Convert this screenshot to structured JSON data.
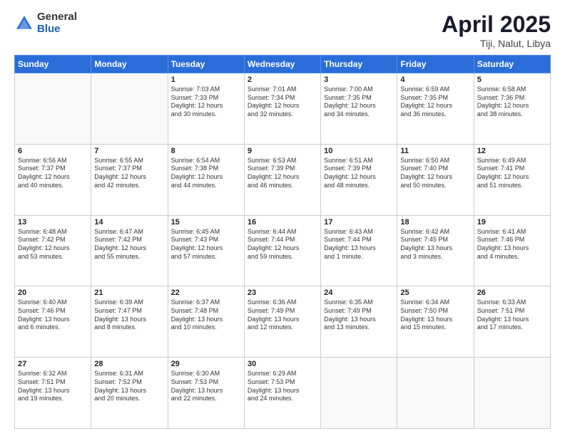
{
  "header": {
    "logo_general": "General",
    "logo_blue": "Blue",
    "title": "April 2025",
    "location": "Tiji, Nalut, Libya"
  },
  "days_of_week": [
    "Sunday",
    "Monday",
    "Tuesday",
    "Wednesday",
    "Thursday",
    "Friday",
    "Saturday"
  ],
  "weeks": [
    [
      {
        "day": "",
        "info": ""
      },
      {
        "day": "",
        "info": ""
      },
      {
        "day": "1",
        "info": "Sunrise: 7:03 AM\nSunset: 7:33 PM\nDaylight: 12 hours\nand 30 minutes."
      },
      {
        "day": "2",
        "info": "Sunrise: 7:01 AM\nSunset: 7:34 PM\nDaylight: 12 hours\nand 32 minutes."
      },
      {
        "day": "3",
        "info": "Sunrise: 7:00 AM\nSunset: 7:35 PM\nDaylight: 12 hours\nand 34 minutes."
      },
      {
        "day": "4",
        "info": "Sunrise: 6:59 AM\nSunset: 7:35 PM\nDaylight: 12 hours\nand 36 minutes."
      },
      {
        "day": "5",
        "info": "Sunrise: 6:58 AM\nSunset: 7:36 PM\nDaylight: 12 hours\nand 38 minutes."
      }
    ],
    [
      {
        "day": "6",
        "info": "Sunrise: 6:56 AM\nSunset: 7:37 PM\nDaylight: 12 hours\nand 40 minutes."
      },
      {
        "day": "7",
        "info": "Sunrise: 6:55 AM\nSunset: 7:37 PM\nDaylight: 12 hours\nand 42 minutes."
      },
      {
        "day": "8",
        "info": "Sunrise: 6:54 AM\nSunset: 7:38 PM\nDaylight: 12 hours\nand 44 minutes."
      },
      {
        "day": "9",
        "info": "Sunrise: 6:53 AM\nSunset: 7:39 PM\nDaylight: 12 hours\nand 46 minutes."
      },
      {
        "day": "10",
        "info": "Sunrise: 6:51 AM\nSunset: 7:39 PM\nDaylight: 12 hours\nand 48 minutes."
      },
      {
        "day": "11",
        "info": "Sunrise: 6:50 AM\nSunset: 7:40 PM\nDaylight: 12 hours\nand 50 minutes."
      },
      {
        "day": "12",
        "info": "Sunrise: 6:49 AM\nSunset: 7:41 PM\nDaylight: 12 hours\nand 51 minutes."
      }
    ],
    [
      {
        "day": "13",
        "info": "Sunrise: 6:48 AM\nSunset: 7:42 PM\nDaylight: 12 hours\nand 53 minutes."
      },
      {
        "day": "14",
        "info": "Sunrise: 6:47 AM\nSunset: 7:42 PM\nDaylight: 12 hours\nand 55 minutes."
      },
      {
        "day": "15",
        "info": "Sunrise: 6:45 AM\nSunset: 7:43 PM\nDaylight: 12 hours\nand 57 minutes."
      },
      {
        "day": "16",
        "info": "Sunrise: 6:44 AM\nSunset: 7:44 PM\nDaylight: 12 hours\nand 59 minutes."
      },
      {
        "day": "17",
        "info": "Sunrise: 6:43 AM\nSunset: 7:44 PM\nDaylight: 13 hours\nand 1 minute."
      },
      {
        "day": "18",
        "info": "Sunrise: 6:42 AM\nSunset: 7:45 PM\nDaylight: 13 hours\nand 3 minutes."
      },
      {
        "day": "19",
        "info": "Sunrise: 6:41 AM\nSunset: 7:46 PM\nDaylight: 13 hours\nand 4 minutes."
      }
    ],
    [
      {
        "day": "20",
        "info": "Sunrise: 6:40 AM\nSunset: 7:46 PM\nDaylight: 13 hours\nand 6 minutes."
      },
      {
        "day": "21",
        "info": "Sunrise: 6:39 AM\nSunset: 7:47 PM\nDaylight: 13 hours\nand 8 minutes."
      },
      {
        "day": "22",
        "info": "Sunrise: 6:37 AM\nSunset: 7:48 PM\nDaylight: 13 hours\nand 10 minutes."
      },
      {
        "day": "23",
        "info": "Sunrise: 6:36 AM\nSunset: 7:49 PM\nDaylight: 13 hours\nand 12 minutes."
      },
      {
        "day": "24",
        "info": "Sunrise: 6:35 AM\nSunset: 7:49 PM\nDaylight: 13 hours\nand 13 minutes."
      },
      {
        "day": "25",
        "info": "Sunrise: 6:34 AM\nSunset: 7:50 PM\nDaylight: 13 hours\nand 15 minutes."
      },
      {
        "day": "26",
        "info": "Sunrise: 6:33 AM\nSunset: 7:51 PM\nDaylight: 13 hours\nand 17 minutes."
      }
    ],
    [
      {
        "day": "27",
        "info": "Sunrise: 6:32 AM\nSunset: 7:51 PM\nDaylight: 13 hours\nand 19 minutes."
      },
      {
        "day": "28",
        "info": "Sunrise: 6:31 AM\nSunset: 7:52 PM\nDaylight: 13 hours\nand 20 minutes."
      },
      {
        "day": "29",
        "info": "Sunrise: 6:30 AM\nSunset: 7:53 PM\nDaylight: 13 hours\nand 22 minutes."
      },
      {
        "day": "30",
        "info": "Sunrise: 6:29 AM\nSunset: 7:53 PM\nDaylight: 13 hours\nand 24 minutes."
      },
      {
        "day": "",
        "info": ""
      },
      {
        "day": "",
        "info": ""
      },
      {
        "day": "",
        "info": ""
      }
    ]
  ]
}
